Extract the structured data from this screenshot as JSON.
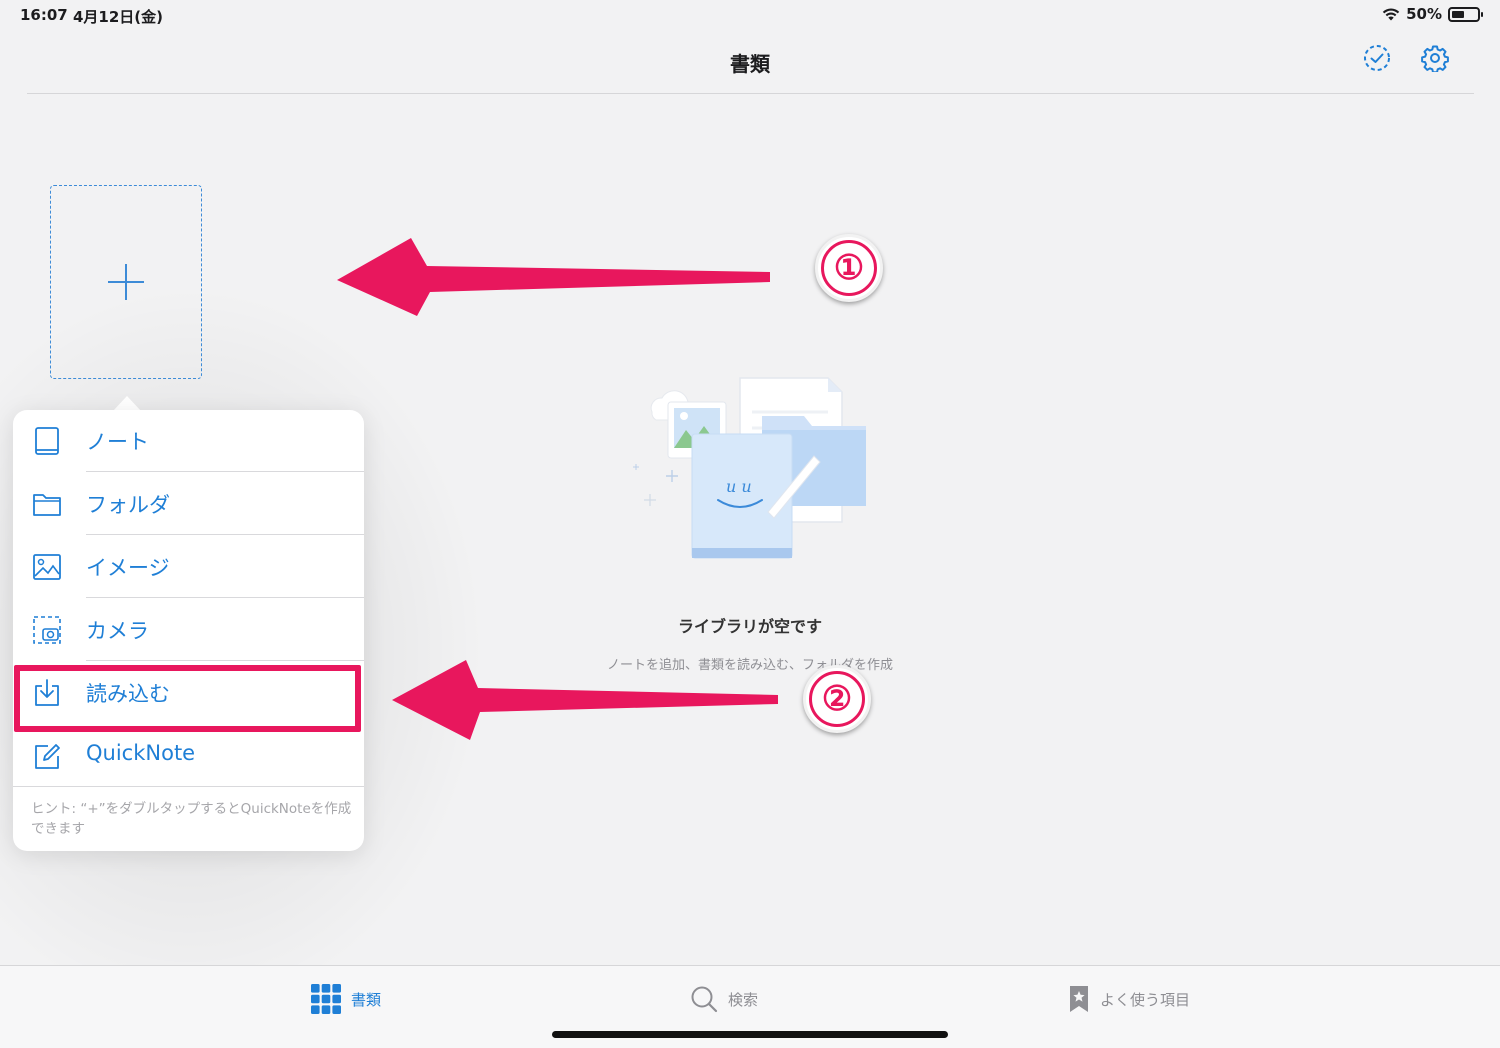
{
  "status_bar": {
    "time": "16:07",
    "date": "4月12日(金)",
    "battery": "50%",
    "battery_level": 0.5
  },
  "nav": {
    "title": "書類",
    "select_icon": "checkmark-circle-dashed-icon",
    "settings_icon": "gear-icon"
  },
  "add_tile": {
    "icon": "plus-icon"
  },
  "annotations": {
    "badge_1": "①",
    "badge_2": "②",
    "arrow_color": "#e8175d"
  },
  "empty_state": {
    "title": "ライブラリが空です",
    "subtitle": "ノートを追加、書類を読み込む、フォルダを作成"
  },
  "menu": {
    "items": [
      {
        "label": "ノート",
        "icon": "notebook-icon"
      },
      {
        "label": "フォルダ",
        "icon": "folder-icon"
      },
      {
        "label": "イメージ",
        "icon": "image-icon"
      },
      {
        "label": "カメラ",
        "icon": "camera-icon"
      },
      {
        "label": "読み込む",
        "icon": "import-icon"
      },
      {
        "label": "QuickNote",
        "icon": "compose-icon"
      }
    ],
    "hint": "ヒント: “+”をダブルタップするとQuickNoteを作成できます"
  },
  "tab_bar": {
    "tabs": [
      {
        "label": "書類",
        "icon": "grid-icon",
        "selected": true
      },
      {
        "label": "検索",
        "icon": "search-icon",
        "selected": false
      },
      {
        "label": "よく使う項目",
        "icon": "bookmark-star-icon",
        "selected": false
      }
    ]
  },
  "colors": {
    "accent": "#1f7fd6",
    "highlight": "#e8175d",
    "background": "#f2f2f3"
  }
}
